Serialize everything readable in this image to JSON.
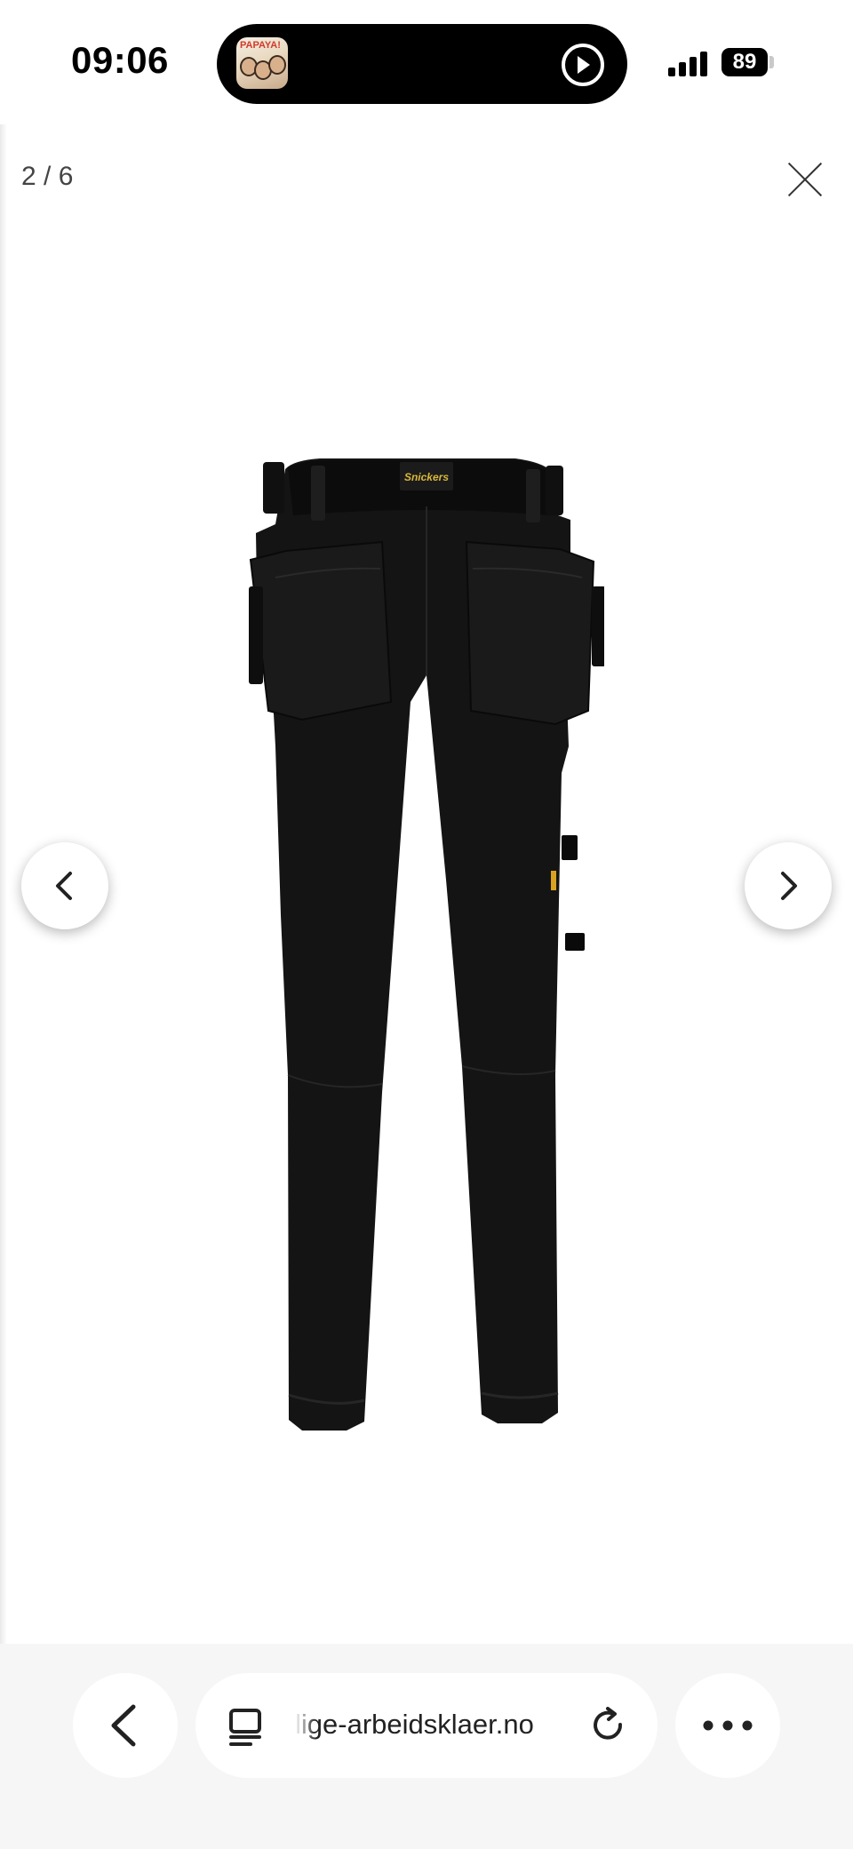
{
  "status_bar": {
    "time": "09:06",
    "now_playing_art_text": "PAPAYA!",
    "battery": "89"
  },
  "gallery": {
    "counter": "2 / 6",
    "image_alt": "Black work trousers with holster pockets, back view",
    "brand_patch_text": "Snickers"
  },
  "browser": {
    "url": "lige-arbeidsklaer.no"
  },
  "icons": {
    "close": "close-icon",
    "prev": "chevron-left-icon",
    "next": "chevron-right-icon",
    "back": "back-arrow-icon",
    "tabs": "tabs-icon",
    "reload": "reload-icon",
    "more": "more-icon"
  }
}
